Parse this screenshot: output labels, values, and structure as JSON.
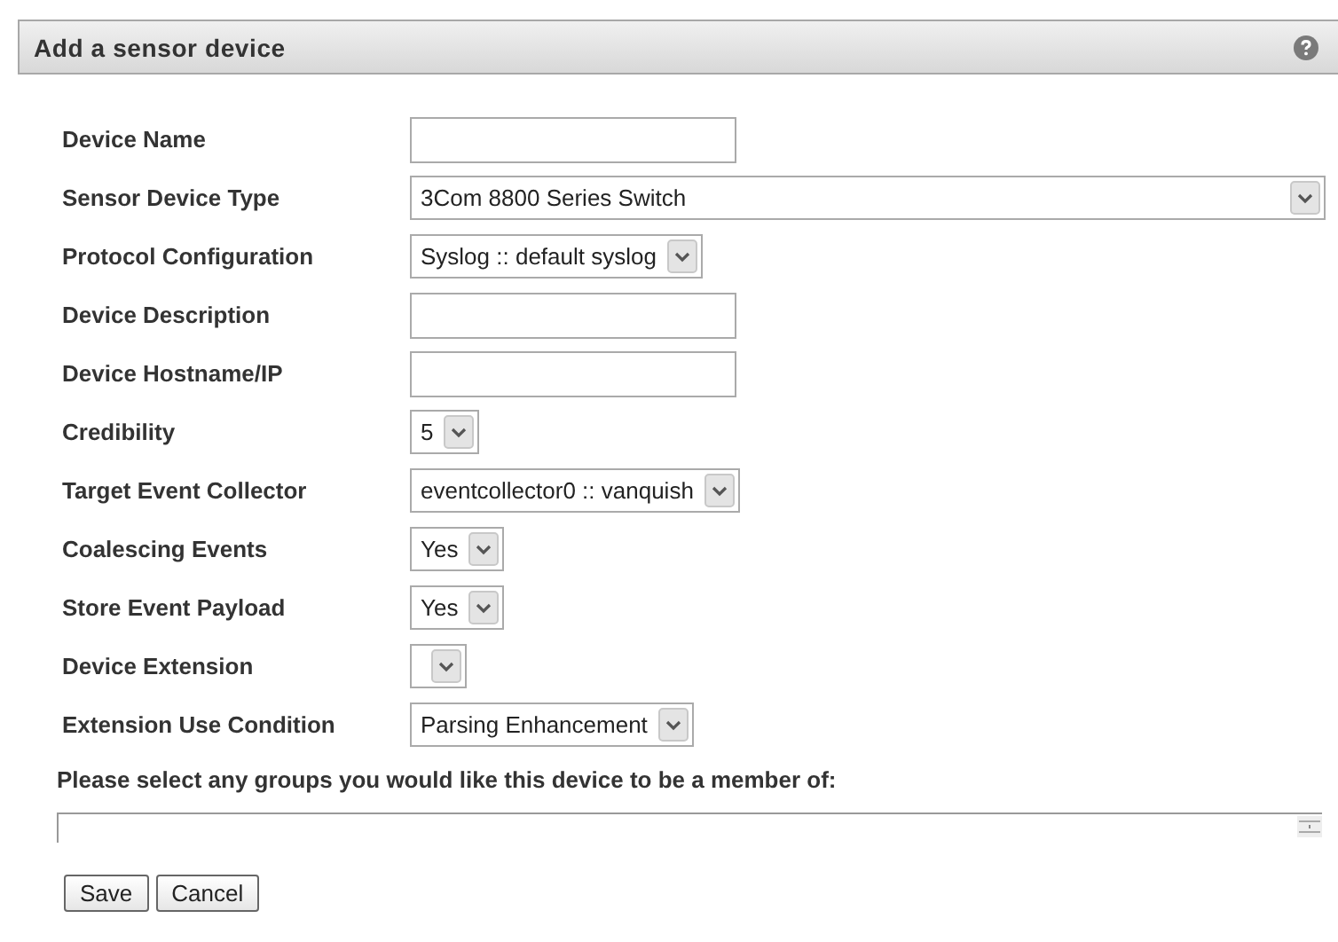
{
  "panel": {
    "title": "Add a sensor device"
  },
  "fields": [
    {
      "label": "Device Name",
      "kind": "text"
    },
    {
      "label": "Sensor Device Type",
      "kind": "select",
      "value": "3Com 8800 Series Switch"
    },
    {
      "label": "Protocol Configuration",
      "kind": "select",
      "value": "Syslog :: default syslog"
    },
    {
      "label": "Device Description",
      "kind": "text"
    },
    {
      "label": "Device Hostname/IP",
      "kind": "text"
    },
    {
      "label": "Credibility",
      "kind": "select",
      "value": "5"
    },
    {
      "label": "Target Event Collector",
      "kind": "select",
      "value": "eventcollector0 :: vanquish"
    },
    {
      "label": "Coalescing Events",
      "kind": "select",
      "value": "Yes"
    },
    {
      "label": "Store Event Payload",
      "kind": "select",
      "value": "Yes"
    },
    {
      "label": "Device Extension",
      "kind": "select"
    },
    {
      "label": "Extension Use Condition",
      "kind": "select",
      "value": "Parsing Enhancement"
    }
  ],
  "groups": {
    "prompt": "Please select any groups you would like this device to be a member of:"
  },
  "buttons": [
    "Save",
    "Cancel"
  ]
}
